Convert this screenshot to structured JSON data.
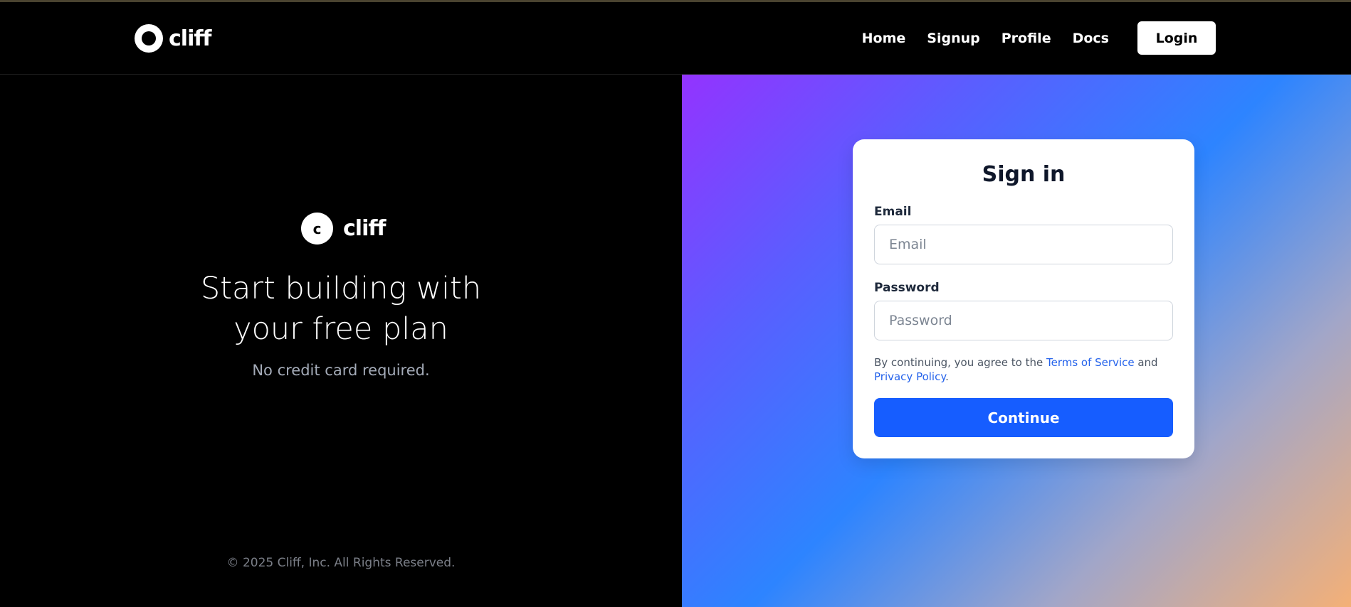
{
  "nav": {
    "brand": "cliff",
    "links": [
      "Home",
      "Signup",
      "Profile",
      "Docs"
    ],
    "login_label": "Login"
  },
  "hero": {
    "logo_letter": "c",
    "logo_text": "cliff",
    "headline_line1": "Start building with",
    "headline_line2": "your free plan",
    "subline": "No credit card required.",
    "copyright": "© 2025 Cliff, Inc. All Rights Reserved."
  },
  "signin": {
    "title": "Sign in",
    "email_label": "Email",
    "email_placeholder": "Email",
    "email_value": "",
    "password_label": "Password",
    "password_placeholder": "Password",
    "password_value": "",
    "terms_prefix": "By continuing, you agree to the ",
    "terms_link": "Terms of Service",
    "terms_and": " and ",
    "privacy_link": "Privacy Policy",
    "terms_suffix": ".",
    "continue_label": "Continue"
  },
  "colors": {
    "primary_button": "#165dff",
    "link": "#2563eb",
    "gradient_start": "#9333ff",
    "gradient_mid": "#2d84ff",
    "gradient_end": "#f4b077"
  }
}
